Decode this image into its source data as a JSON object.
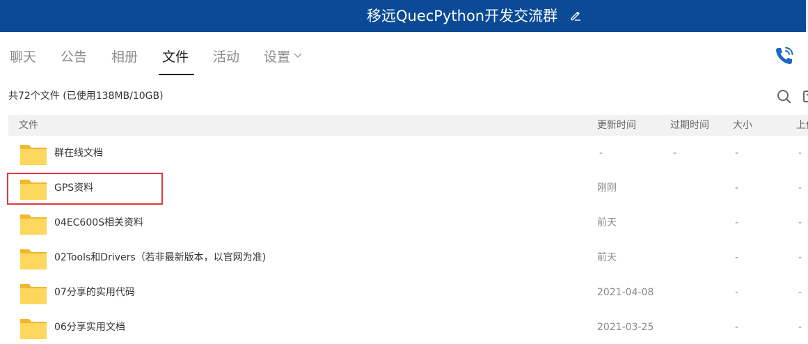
{
  "header": {
    "title": "移远QuecPython开发交流群",
    "edit_icon": "pencil-icon",
    "bg_color": "#0a4a96"
  },
  "tabs": [
    {
      "label": "聊天",
      "active": false
    },
    {
      "label": "公告",
      "active": false
    },
    {
      "label": "相册",
      "active": false
    },
    {
      "label": "文件",
      "active": true
    },
    {
      "label": "活动",
      "active": false
    },
    {
      "label": "设置",
      "active": false,
      "has_dropdown": true
    }
  ],
  "toolbar": {
    "summary": "共72个文件 (已使用138MB/10GB)",
    "phone_icon": "phone-icon",
    "search_icon": "search-icon",
    "upload_icon": "upload-icon"
  },
  "table": {
    "columns": [
      "文件",
      "更新时间",
      "过期时间",
      "大小",
      "上传"
    ],
    "rows": [
      {
        "name": "群在线文档",
        "updated": "-",
        "expires": "-",
        "size": "-",
        "uploader": "-"
      },
      {
        "name": "GPS资料",
        "updated": "刚刚",
        "expires": "",
        "size": "-",
        "uploader": "-",
        "highlighted": true
      },
      {
        "name": "04EC600S相关资料",
        "updated": "前天",
        "expires": "",
        "size": "-",
        "uploader": "-"
      },
      {
        "name": "02Tools和Drivers（若非最新版本，以官网为准)",
        "updated": "前天",
        "expires": "",
        "size": "-",
        "uploader": "-"
      },
      {
        "name": "07分享的实用代码",
        "updated": "2021-04-08",
        "expires": "",
        "size": "-",
        "uploader": "-"
      },
      {
        "name": "06分享实用文档",
        "updated": "2021-03-25",
        "expires": "",
        "size": "-",
        "uploader": "-"
      }
    ]
  },
  "colors": {
    "folder": "#fdd75e",
    "folder_tab": "#f0b72f",
    "highlight": "#e0383e",
    "accent": "#1a66c4"
  }
}
